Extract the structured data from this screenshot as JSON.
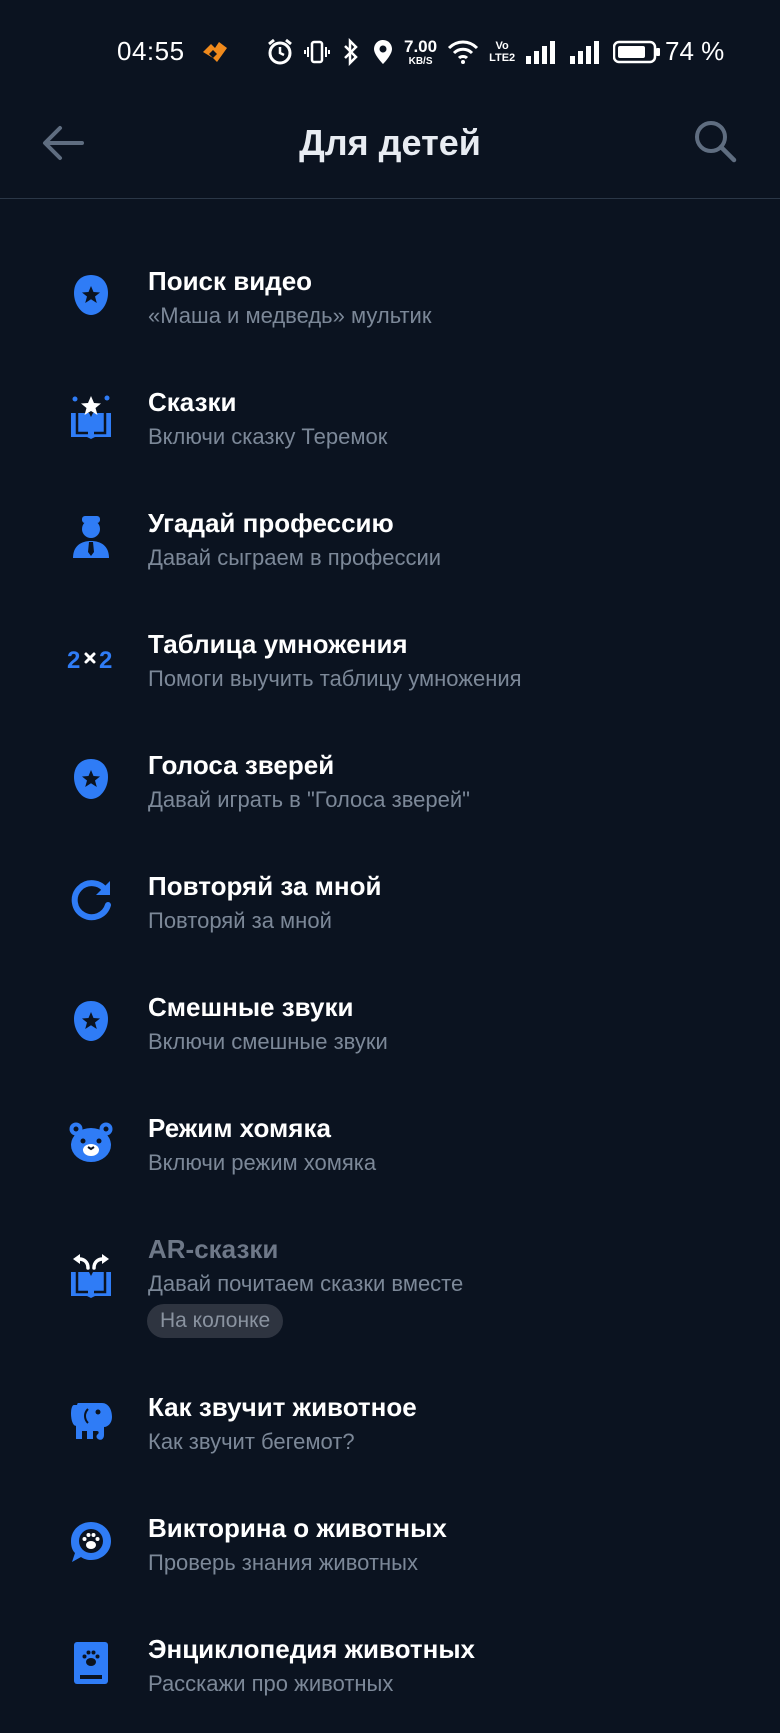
{
  "status_bar": {
    "time": "04:55",
    "speed_value": "7.00",
    "speed_unit": "KB/S",
    "volte_top": "Vo",
    "volte_bottom": "LTE2",
    "battery_percent": "74 %"
  },
  "header": {
    "title": "Для детей"
  },
  "colors": {
    "background": "#0b1320",
    "accent": "#2f7cf6",
    "subtitle": "#7c8898"
  },
  "items": [
    {
      "title": "Поиск видео",
      "subtitle": "«Маша и медведь» мультик",
      "icon": "star-shield-icon"
    },
    {
      "title": "Сказки",
      "subtitle": "Включи сказку Теремок",
      "icon": "storybook-icon"
    },
    {
      "title": "Угадай профессию",
      "subtitle": "Давай сыграем в профессии",
      "icon": "person-icon"
    },
    {
      "title": "Таблица умножения",
      "subtitle": "Помоги выучить таблицу умножения",
      "icon": "multiplication-icon"
    },
    {
      "title": "Голоса зверей",
      "subtitle": "Давай играть в \"Голоса зверей\"",
      "icon": "star-shield-icon"
    },
    {
      "title": "Повторяй за мной",
      "subtitle": "Повторяй за мной",
      "icon": "repeat-icon"
    },
    {
      "title": "Смешные звуки",
      "subtitle": "Включи смешные звуки",
      "icon": "star-shield-icon"
    },
    {
      "title": "Режим хомяка",
      "subtitle": "Включи режим хомяка",
      "icon": "hamster-icon"
    },
    {
      "title": "AR-сказки",
      "subtitle": "Давай  почитаем сказки вместе",
      "badge": "На колонке",
      "icon": "ar-book-icon"
    },
    {
      "title": "Как звучит животное",
      "subtitle": "Как звучит бегемот?",
      "icon": "elephant-icon"
    },
    {
      "title": "Викторина о животных",
      "subtitle": "Проверь знания животных",
      "icon": "paw-chat-icon"
    },
    {
      "title": "Энциклопедия животных",
      "subtitle": "Расскажи про животных",
      "icon": "paw-book-icon"
    }
  ]
}
